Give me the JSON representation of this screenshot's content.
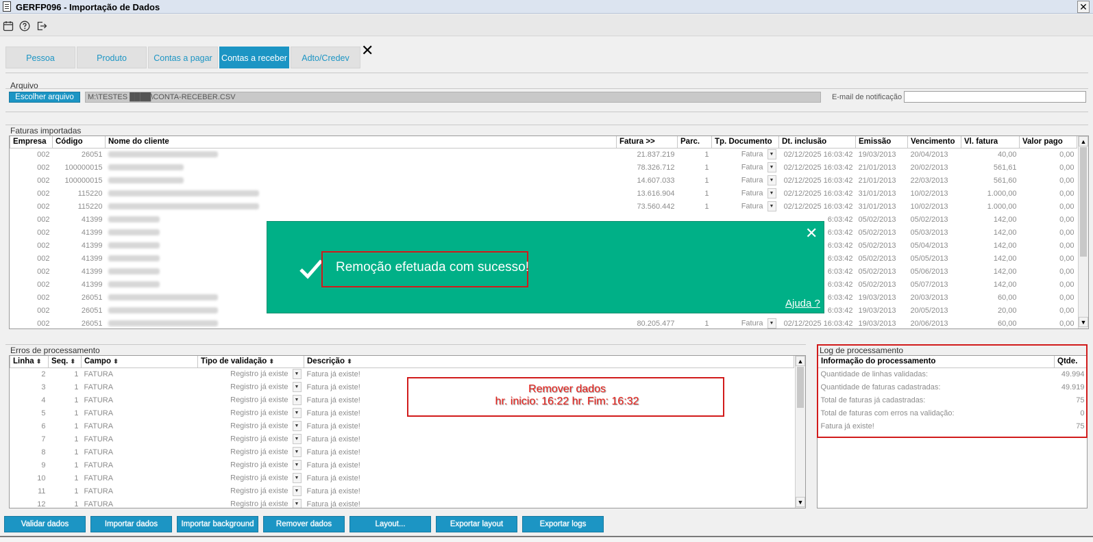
{
  "window": {
    "title": "GERFP096 - Importação de Dados",
    "close": "✕"
  },
  "tabs": [
    "Pessoa",
    "Produto",
    "Contas a pagar",
    "Contas a receber",
    "Adto/Credev"
  ],
  "tab_close": "✕",
  "arquivo": {
    "section": "Arquivo",
    "choose_button": "Escolher arquivo",
    "path": "M:\\TESTES ████\\CONTA-RECEBER.CSV",
    "email_label": "E-mail de notificação",
    "email_value": ""
  },
  "faturas": {
    "section": "Faturas importadas",
    "columns": [
      "Empresa",
      "Código",
      "Nome do cliente",
      "Fatura >>",
      "Parc.",
      "Tp. Documento",
      "Dt. inclusão",
      "Emissão",
      "Vencimento",
      "Vl. fatura",
      "Valor pago"
    ],
    "rows": [
      {
        "empresa": "002",
        "codigo": "26051",
        "fatura": "21.837.219",
        "parc": "1",
        "tp": "Fatura",
        "dt": "02/12/2025 16:03:42",
        "emissao": "19/03/2013",
        "venc": "20/04/2013",
        "vl": "40,00",
        "pago": "0,00"
      },
      {
        "empresa": "002",
        "codigo": "100000015",
        "fatura": "78.326.712",
        "parc": "1",
        "tp": "Fatura",
        "dt": "02/12/2025 16:03:42",
        "emissao": "21/01/2013",
        "venc": "20/02/2013",
        "vl": "561,61",
        "pago": "0,00"
      },
      {
        "empresa": "002",
        "codigo": "100000015",
        "fatura": "14.607.033",
        "parc": "1",
        "tp": "Fatura",
        "dt": "02/12/2025 16:03:42",
        "emissao": "21/01/2013",
        "venc": "22/03/2013",
        "vl": "561,60",
        "pago": "0,00"
      },
      {
        "empresa": "002",
        "codigo": "115220",
        "fatura": "13.616.904",
        "parc": "1",
        "tp": "Fatura",
        "dt": "02/12/2025 16:03:42",
        "emissao": "31/01/2013",
        "venc": "10/02/2013",
        "vl": "1.000,00",
        "pago": "0,00"
      },
      {
        "empresa": "002",
        "codigo": "115220",
        "fatura": "73.560.442",
        "parc": "1",
        "tp": "Fatura",
        "dt": "02/12/2025 16:03:42",
        "emissao": "31/01/2013",
        "venc": "10/02/2013",
        "vl": "1.000,00",
        "pago": "0,00"
      },
      {
        "empresa": "002",
        "codigo": "41399",
        "fatura": "",
        "parc": "",
        "tp": "",
        "dt": "6:03:42",
        "emissao": "05/02/2013",
        "venc": "05/02/2013",
        "vl": "142,00",
        "pago": "0,00"
      },
      {
        "empresa": "002",
        "codigo": "41399",
        "fatura": "",
        "parc": "",
        "tp": "",
        "dt": "6:03:42",
        "emissao": "05/02/2013",
        "venc": "05/03/2013",
        "vl": "142,00",
        "pago": "0,00"
      },
      {
        "empresa": "002",
        "codigo": "41399",
        "fatura": "",
        "parc": "",
        "tp": "",
        "dt": "6:03:42",
        "emissao": "05/02/2013",
        "venc": "05/04/2013",
        "vl": "142,00",
        "pago": "0,00"
      },
      {
        "empresa": "002",
        "codigo": "41399",
        "fatura": "",
        "parc": "",
        "tp": "",
        "dt": "6:03:42",
        "emissao": "05/02/2013",
        "venc": "05/05/2013",
        "vl": "142,00",
        "pago": "0,00"
      },
      {
        "empresa": "002",
        "codigo": "41399",
        "fatura": "",
        "parc": "",
        "tp": "",
        "dt": "6:03:42",
        "emissao": "05/02/2013",
        "venc": "05/06/2013",
        "vl": "142,00",
        "pago": "0,00"
      },
      {
        "empresa": "002",
        "codigo": "41399",
        "fatura": "",
        "parc": "",
        "tp": "",
        "dt": "6:03:42",
        "emissao": "05/02/2013",
        "venc": "05/07/2013",
        "vl": "142,00",
        "pago": "0,00"
      },
      {
        "empresa": "002",
        "codigo": "26051",
        "fatura": "",
        "parc": "",
        "tp": "",
        "dt": "6:03:42",
        "emissao": "19/03/2013",
        "venc": "20/03/2013",
        "vl": "60,00",
        "pago": "0,00"
      },
      {
        "empresa": "002",
        "codigo": "26051",
        "fatura": "",
        "parc": "",
        "tp": "",
        "dt": "6:03:42",
        "emissao": "19/03/2013",
        "venc": "20/05/2013",
        "vl": "20,00",
        "pago": "0,00"
      },
      {
        "empresa": "002",
        "codigo": "26051",
        "fatura": "80.205.477",
        "parc": "1",
        "tp": "Fatura",
        "dt": "02/12/2025 16:03:42",
        "emissao": "19/03/2013",
        "venc": "20/06/2013",
        "vl": "60,00",
        "pago": "0,00"
      }
    ]
  },
  "toast": {
    "message": "Remoção efetuada com sucesso!",
    "help": "Ajuda ?",
    "close": "✕",
    "color": "#00b087"
  },
  "erros": {
    "section": "Erros de processamento",
    "columns": [
      "Linha",
      "Seq.",
      "Campo",
      "Tipo de validação",
      "Descrição"
    ],
    "rows": [
      {
        "linha": "2",
        "seq": "1",
        "campo": "FATURA",
        "tipo": "Registro já existe",
        "desc": "Fatura já existe!"
      },
      {
        "linha": "3",
        "seq": "1",
        "campo": "FATURA",
        "tipo": "Registro já existe",
        "desc": "Fatura já existe!"
      },
      {
        "linha": "4",
        "seq": "1",
        "campo": "FATURA",
        "tipo": "Registro já existe",
        "desc": "Fatura já existe!"
      },
      {
        "linha": "5",
        "seq": "1",
        "campo": "FATURA",
        "tipo": "Registro já existe",
        "desc": "Fatura já existe!"
      },
      {
        "linha": "6",
        "seq": "1",
        "campo": "FATURA",
        "tipo": "Registro já existe",
        "desc": "Fatura já existe!"
      },
      {
        "linha": "7",
        "seq": "1",
        "campo": "FATURA",
        "tipo": "Registro já existe",
        "desc": "Fatura já existe!"
      },
      {
        "linha": "8",
        "seq": "1",
        "campo": "FATURA",
        "tipo": "Registro já existe",
        "desc": "Fatura já existe!"
      },
      {
        "linha": "9",
        "seq": "1",
        "campo": "FATURA",
        "tipo": "Registro já existe",
        "desc": "Fatura já existe!"
      },
      {
        "linha": "10",
        "seq": "1",
        "campo": "FATURA",
        "tipo": "Registro já existe",
        "desc": "Fatura já existe!"
      },
      {
        "linha": "11",
        "seq": "1",
        "campo": "FATURA",
        "tipo": "Registro já existe",
        "desc": "Fatura já existe!"
      },
      {
        "linha": "12",
        "seq": "1",
        "campo": "FATURA",
        "tipo": "Registro já existe",
        "desc": "Fatura já existe!"
      }
    ]
  },
  "annotation": {
    "line1": "Remover dados",
    "line2": "hr. inicio:  16:22  hr. Fim:  16:32"
  },
  "log": {
    "section": "Log de processamento",
    "columns": [
      "Informação do processamento",
      "Qtde."
    ],
    "rows": [
      {
        "info": "Quantidade de linhas validadas:",
        "qtde": "49.994"
      },
      {
        "info": "Quantidade de faturas cadastradas:",
        "qtde": "49.919"
      },
      {
        "info": "Total de faturas já cadastradas:",
        "qtde": "75"
      },
      {
        "info": "Total de faturas com erros na validação:",
        "qtde": "0"
      },
      {
        "info": "Fatura já existe!",
        "qtde": "75"
      }
    ]
  },
  "buttons": [
    "Validar dados",
    "Importar dados",
    "Importar background",
    "Remover dados",
    "Layout...",
    "Exportar layout",
    "Exportar logs"
  ],
  "icons": [
    "calendar-icon",
    "help-icon",
    "exit-icon",
    "checkmark-icon",
    "close-icon",
    "sort-icon",
    "dropdown-arrow-icon"
  ],
  "colors": {
    "accent": "#1c95c4",
    "toast": "#00b087",
    "annotation": "#d11a1a"
  }
}
